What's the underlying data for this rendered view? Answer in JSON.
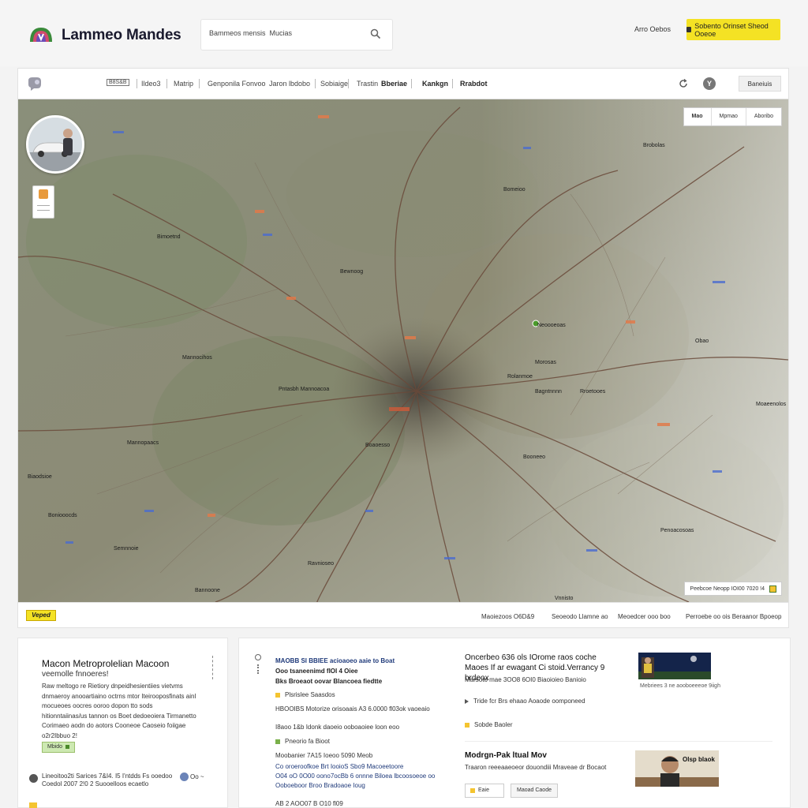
{
  "header": {
    "brand": "Lammeo Mandes",
    "search_value": "Bammeos mensis  Mucias",
    "top_link": "Arro Oebos",
    "cta_label": "Sobento Orinset Sheod Ooeoe"
  },
  "toolbar": {
    "badge": "B8S&B",
    "items": [
      "Ildeo3",
      "Matrip",
      "Genponila Fonvoo",
      "Jaron lbdobo",
      "Sobiaige",
      "Trastin",
      "Bberiae",
      "Kankgn",
      "Rrabdot"
    ],
    "menu_button": "Baneiuis"
  },
  "map": {
    "layers": [
      "Mao",
      "Mpmao",
      "Aboribo"
    ],
    "scale_text": "Peebcoe Neopp  IOI00 7020 !4",
    "labels": [
      "Mannocihos",
      "Bimoetnd",
      "Mannopaacs",
      "Pntasbh Mannoacoa",
      "Bewnoog",
      "Boaoesso",
      "Bomeioo",
      "Neoooeoas",
      "Brobolas",
      "Rolanmoe",
      "Bagntnnnn",
      "Rroetooes",
      "Booneeo",
      "Biaodsioe",
      "Boniooocds",
      "Ravnioseo",
      "Penoacosoas",
      "Semnnoie",
      "Obao",
      "Moaeenolos",
      "Morosas",
      "Bannoone",
      "Vnnisto"
    ]
  },
  "map_footer": {
    "logo": "Veped",
    "items": [
      "Maoiezoos  O6D&9",
      "Seoeodo Llamne ao",
      "Meoedcer ooo boo",
      "Perroebe oo ois  Beraanor Bpoeop"
    ]
  },
  "left_card": {
    "title": "Macon Metroprolelian Macoon",
    "subtitle": "veemolle fnnoeres!",
    "body": "Raw meltogo re Rietiory dnpeidhesientiies vietvms dnmaeroy anooartiaino octrns mtor Iteirooposfinats ainl mocueoes oocres ooroo dopon tto sods hitionntaiinas/us tannon os Boet dedoeoiera Tirmanetto Corimaeo aodn do aotors Cooneoe Caoseio foiigae o2r2Ibbuo 2!",
    "tag": "Mbido",
    "meta": "Lineoitoo2ti Sarices 7&I4. I5 I'ntdds Fs ooedoo Coedol 2007 2!0 2  Suooelloos ecaetlo",
    "meta_ctrl": "Oo ~"
  },
  "mid_card": {
    "head_line1": "MAOBB Sl BBIEE acioaoeo aaie to Boat",
    "head_line2": "Ooo tsaneenimd fIOI 4 Oiee",
    "head_line3": "Bks  Broeaot oovar Blancoea fiedtte",
    "items": [
      {
        "icon": "Plsrislee Saasdos",
        "text": ""
      },
      {
        "icon": "",
        "text": "HBOOIBS Motorize  orisoaais A3 6.0000 fl03ok vaoeaio"
      },
      {
        "icon": "",
        "text": "I8aoo 1&b Idonk daoeio ooboaoiee loon eoo"
      },
      {
        "icon": "Pneorio fa Bioot",
        "text": ""
      },
      {
        "icon": "",
        "text": "Moobanier 7A15 Ioeoo 5090 Meob"
      },
      {
        "icon": "",
        "text": "Co oroeroofkoe Brt IooioS Sbo9 Macoeetoore"
      },
      {
        "icon": "",
        "text": "O04 oO 0O00  oono7ocBb 6 onnne Biloea  lbcoosoeoe oo"
      },
      {
        "icon": "",
        "text": "Ooboeboor Broo Bradoaoe Ioug"
      },
      {
        "icon": "",
        "text": "AB 2 AOO07 B O10 fl09"
      }
    ],
    "news1_title_a": "Oncerbeo 636 ols IOrome raos coche",
    "news1_title_b": "Maoes If ar ewagant Ci stoid.Verrancy 9 brdeox",
    "news1_sub": "Marsoto mae 3OO8 6OI0 Biaoioieo Banioio",
    "news1_caption": "Mebriees  3 ne aooboeeeoe  9iigh",
    "news1_links": [
      "Tride fcr Brs ehaao Aoaode oomponeed",
      "Sobde Baoler"
    ],
    "news2_title": "Modrgn-Pak ltual Mov",
    "news2_sub": "Traaron reeeaaeoeor douondiii Mraveae dr Bocaot",
    "btn_a": "Eaie",
    "btn_b": "Maoad Caode",
    "news2_thumb_text": "Olsp blaok"
  },
  "colors": {
    "accent_yellow": "#f4e224",
    "link_blue": "#1f3a7a",
    "tag_green": "#cde9b2"
  },
  "icons": {
    "logo": "app-logo-icon",
    "search": "search-icon",
    "refresh": "refresh-icon",
    "help": "help-icon",
    "zoom": "zoom-control",
    "globe": "globe-icon"
  }
}
